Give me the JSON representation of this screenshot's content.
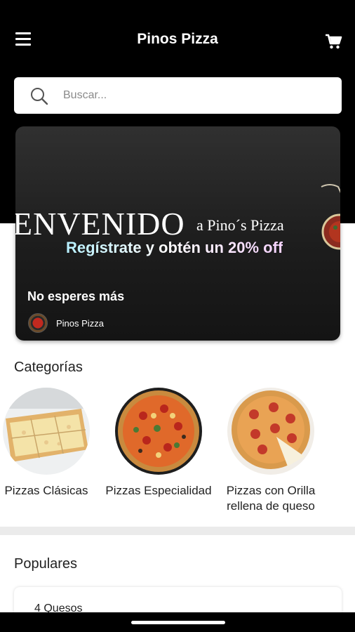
{
  "app": {
    "title": "Pinos Pizza"
  },
  "search": {
    "placeholder": "Buscar..."
  },
  "banner": {
    "headline": "ENVENIDO",
    "headline_sub": "a Pino´s Pizza",
    "promo": "Regístrate y obtén un 20% off",
    "caption": "No esperes más",
    "brand": "Pinos Pizza"
  },
  "categories": {
    "title": "Categorías",
    "items": [
      {
        "label": "Pizzas Clásicas"
      },
      {
        "label": "Pizzas Especialidad"
      },
      {
        "label": "Pizzas con Orilla rellena de queso"
      }
    ]
  },
  "populares": {
    "title": "Populares",
    "items": [
      {
        "name": "4 Quesos"
      }
    ]
  },
  "icons": {
    "menu": "menu-icon",
    "cart": "cart-icon",
    "search": "search-icon"
  },
  "colors": {
    "header": "#000000",
    "background": "#ffffff",
    "divider": "#ebebeb"
  }
}
